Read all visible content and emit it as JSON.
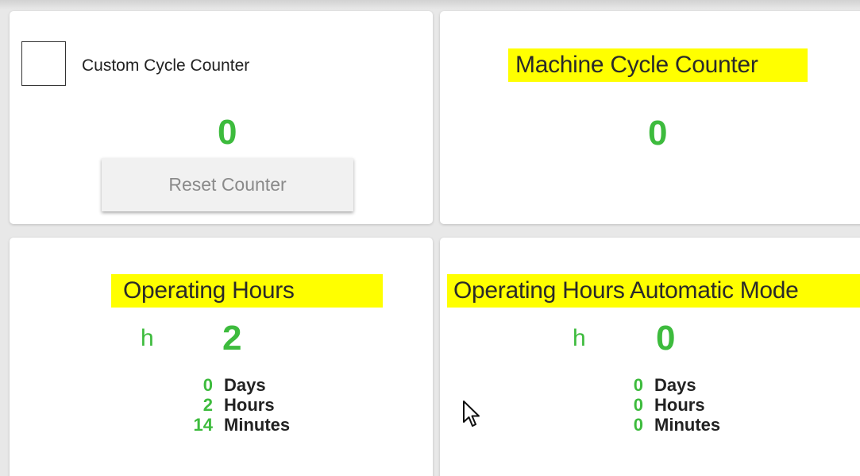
{
  "custom_cycle_counter": {
    "checkbox_label": "Custom Cycle Counter",
    "value": "0",
    "reset_label": "Reset Counter"
  },
  "machine_cycle_counter": {
    "title": "Machine Cycle Counter",
    "value": "0"
  },
  "operating_hours": {
    "title": "Operating Hours",
    "unit": "h",
    "value": "2",
    "breakdown": [
      {
        "value": "0",
        "label": "Days"
      },
      {
        "value": "2",
        "label": "Hours"
      },
      {
        "value": "14",
        "label": "Minutes"
      }
    ]
  },
  "operating_hours_auto": {
    "title": "Operating Hours Automatic Mode",
    "unit": "h",
    "value": "0",
    "breakdown": [
      {
        "value": "0",
        "label": "Days"
      },
      {
        "value": "0",
        "label": "Hours"
      },
      {
        "value": "0",
        "label": "Minutes"
      }
    ]
  },
  "colors": {
    "value_green": "#3dbb3d",
    "highlight_yellow": "#ffff00",
    "card_background": "#ffffff",
    "page_background": "#e8e8e8"
  }
}
